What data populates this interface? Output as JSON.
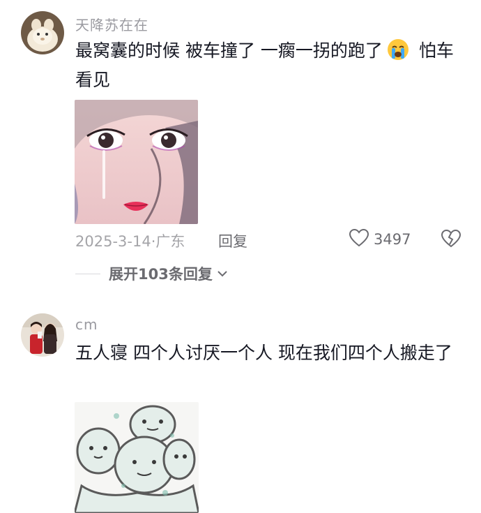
{
  "comments": [
    {
      "username": "天降苏在在",
      "text_before_emoji": "最窝囊的时候  被车撞了 一瘸一拐的跑了",
      "text_after_emoji": " 怕车看见",
      "emoji": "crying-face-emoji",
      "date": "2025-3-14",
      "location": "广东",
      "reply_label": "回复",
      "likes": "3497",
      "expand_label": "展开103条回复"
    },
    {
      "username": "cm",
      "text": "五人寝 四个人讨厌一个人 现在我们四个人搬走了"
    }
  ],
  "colors": {
    "text": "#161823",
    "meta": "#a4a4a8",
    "username": "#9a9aa0"
  }
}
